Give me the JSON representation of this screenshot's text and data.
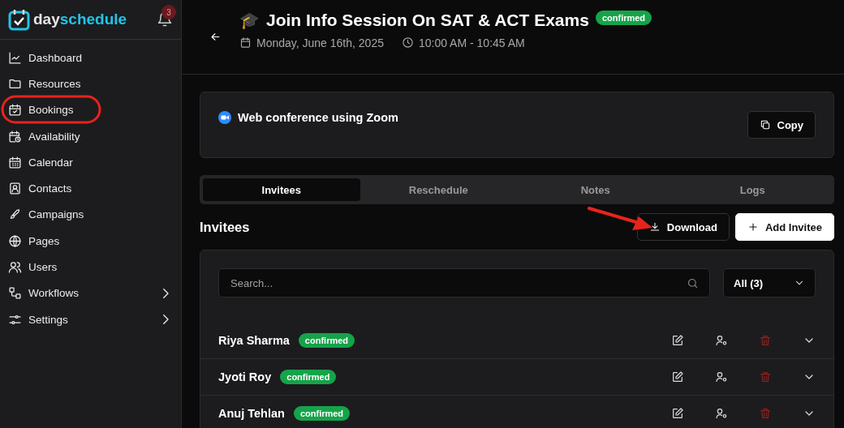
{
  "sidebar": {
    "logo": {
      "prefix": "day",
      "suffix": "schedule"
    },
    "notification_count": "3",
    "items": [
      {
        "label": "Dashboard",
        "has_submenu": false
      },
      {
        "label": "Resources",
        "has_submenu": false
      },
      {
        "label": "Bookings",
        "has_submenu": false
      },
      {
        "label": "Availability",
        "has_submenu": false
      },
      {
        "label": "Calendar",
        "has_submenu": false
      },
      {
        "label": "Contacts",
        "has_submenu": false
      },
      {
        "label": "Campaigns",
        "has_submenu": false
      },
      {
        "label": "Pages",
        "has_submenu": false
      },
      {
        "label": "Users",
        "has_submenu": false
      },
      {
        "label": "Workflows",
        "has_submenu": true
      },
      {
        "label": "Settings",
        "has_submenu": true
      }
    ]
  },
  "header": {
    "emoji": "🎓",
    "title": "Join Info Session On SAT & ACT Exams",
    "status": "confirmed",
    "date": "Monday, June 16th, 2025",
    "time": "10:00 AM - 10:45 AM"
  },
  "location": {
    "label": "Web conference using Zoom",
    "copy_button": "Copy"
  },
  "tabs": [
    {
      "label": "Invitees",
      "selected": true
    },
    {
      "label": "Reschedule",
      "selected": false
    },
    {
      "label": "Notes",
      "selected": false
    },
    {
      "label": "Logs",
      "selected": false
    }
  ],
  "invitees": {
    "heading": "Invitees",
    "download_button": "Download",
    "add_button": "Add Invitee",
    "search": {
      "placeholder": "Search..."
    },
    "filter": "All (3)",
    "rows": [
      {
        "name": "Riya Sharma",
        "status": "confirmed"
      },
      {
        "name": "Jyoti Roy",
        "status": "confirmed"
      },
      {
        "name": "Anuj Tehlan",
        "status": "confirmed"
      }
    ]
  }
}
